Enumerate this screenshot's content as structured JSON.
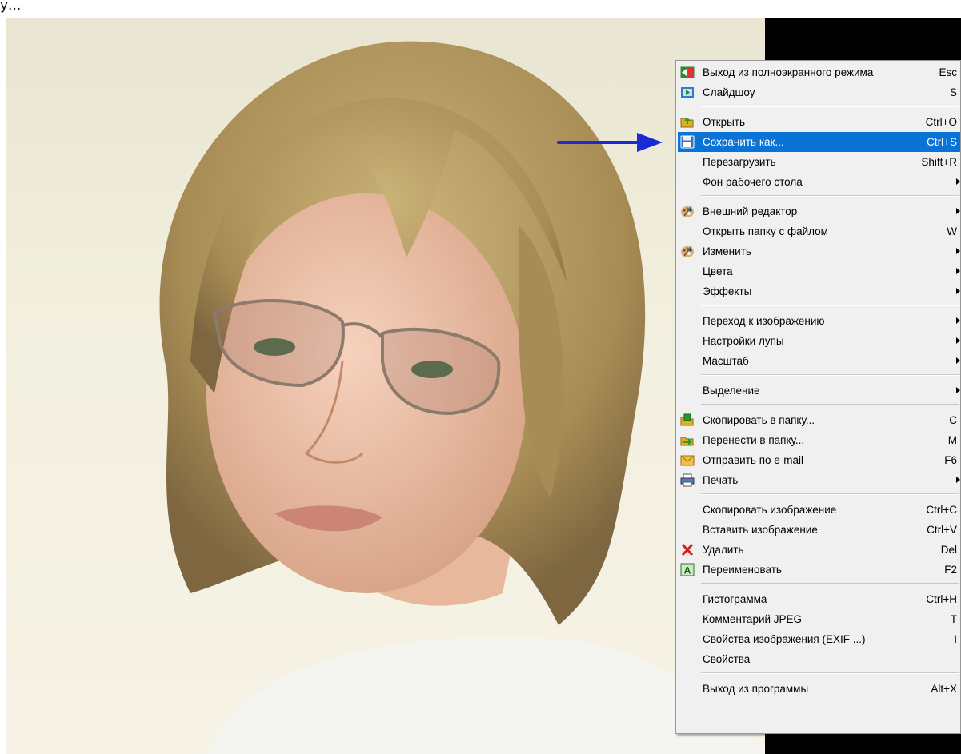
{
  "caption": {
    "text": "у..."
  },
  "context_menu": {
    "items": [
      {
        "label": "Выход из полноэкранного режима",
        "shortcut": "Esc",
        "icon": "exit-fullscreen-icon"
      },
      {
        "label": "Слайдшоу",
        "shortcut": "S",
        "icon": "slideshow-icon"
      },
      {
        "label": "Открыть",
        "shortcut": "Ctrl+O",
        "icon": "open-folder-icon"
      },
      {
        "label": "Сохранить как...",
        "shortcut": "Ctrl+S",
        "icon": "save-icon",
        "highlighted": true
      },
      {
        "label": "Перезагрузить",
        "shortcut": "Shift+R"
      },
      {
        "label": "Фон рабочего стола",
        "submenu": true
      },
      {
        "label": "Внешний редактор",
        "submenu": true,
        "icon": "palette-icon"
      },
      {
        "label": "Открыть папку с файлом",
        "shortcut": "W"
      },
      {
        "label": "Изменить",
        "submenu": true,
        "icon": "palette-icon"
      },
      {
        "label": "Цвета",
        "submenu": true
      },
      {
        "label": "Эффекты",
        "submenu": true
      },
      {
        "label": "Переход к изображению",
        "submenu": true
      },
      {
        "label": "Настройки лупы",
        "submenu": true
      },
      {
        "label": "Масштаб",
        "submenu": true
      },
      {
        "label": "Выделение",
        "submenu": true
      },
      {
        "label": "Скопировать в папку...",
        "shortcut": "C",
        "icon": "copy-to-folder-icon"
      },
      {
        "label": "Перенести в папку...",
        "shortcut": "M",
        "icon": "move-to-folder-icon"
      },
      {
        "label": "Отправить по e-mail",
        "shortcut": "F6",
        "icon": "email-icon"
      },
      {
        "label": "Печать",
        "submenu": true,
        "icon": "printer-icon"
      },
      {
        "label": "Скопировать изображение",
        "shortcut": "Ctrl+C"
      },
      {
        "label": "Вставить изображение",
        "shortcut": "Ctrl+V"
      },
      {
        "label": "Удалить",
        "shortcut": "Del",
        "icon": "delete-icon"
      },
      {
        "label": "Переименовать",
        "shortcut": "F2",
        "icon": "rename-icon"
      },
      {
        "label": "Гистограмма",
        "shortcut": "Ctrl+H"
      },
      {
        "label": "Комментарий JPEG",
        "shortcut": "T"
      },
      {
        "label": "Свойства изображения (EXIF ...)",
        "shortcut": "I"
      },
      {
        "label": "Свойства"
      },
      {
        "label": "Выход из программы",
        "shortcut": "Alt+X"
      }
    ]
  },
  "colors": {
    "highlight": "#0a73d6",
    "arrow": "#1a2bd6",
    "menu_bg": "#f0f0f0"
  }
}
